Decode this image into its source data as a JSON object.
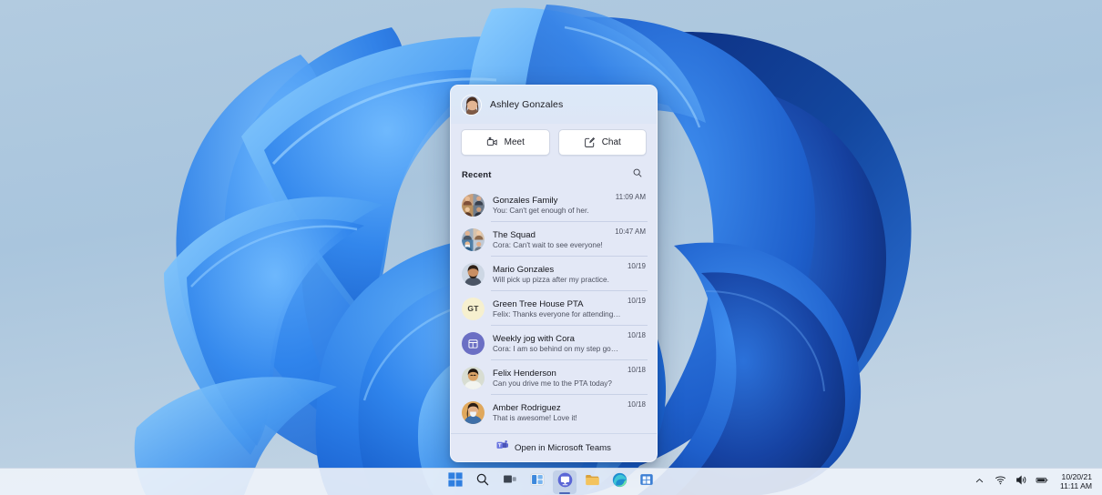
{
  "desktop": {
    "wallpaper_name": "windows-11-bloom-wallpaper",
    "background_color": "#a9c5dd"
  },
  "chat_flyout": {
    "account": {
      "name": "Ashley Gonzales",
      "avatar_name": "ashley-gonzales-avatar"
    },
    "actions": [
      {
        "label": "Meet",
        "icon": "video-camera-icon"
      },
      {
        "label": "Chat",
        "icon": "compose-message-icon"
      }
    ],
    "recent": {
      "title": "Recent",
      "search_icon": "search-icon"
    },
    "chats": [
      {
        "name": "Gonzales Family",
        "preview": "You: Can't get enough of her.",
        "time": "11:09 AM",
        "avatar_type": "group",
        "avatar_name": "gonzales-family-group-avatar"
      },
      {
        "name": "The Squad",
        "preview": "Cora: Can't wait to see everyone!",
        "time": "10:47 AM",
        "avatar_type": "group",
        "avatar_name": "the-squad-group-avatar"
      },
      {
        "name": "Mario Gonzales",
        "preview": "Will pick up pizza after my practice.",
        "time": "10/19",
        "avatar_type": "photo",
        "avatar_name": "mario-gonzales-avatar"
      },
      {
        "name": "Green Tree House PTA",
        "preview": "Felix: Thanks everyone for attending today.",
        "time": "10/19",
        "avatar_type": "initials",
        "avatar_initials": "GT",
        "avatar_color": "#f6f0cf",
        "avatar_name": "green-tree-house-pta-avatar"
      },
      {
        "name": "Weekly jog with Cora",
        "preview": "Cora: I am so behind on my step goals.",
        "time": "10/18",
        "avatar_type": "glyph",
        "avatar_color": "#6b6fc4",
        "avatar_name": "weekly-jog-calendar-avatar"
      },
      {
        "name": "Felix Henderson",
        "preview": "Can you drive me to the PTA today?",
        "time": "10/18",
        "avatar_type": "photo",
        "avatar_name": "felix-henderson-avatar"
      },
      {
        "name": "Amber Rodriguez",
        "preview": "That is awesome! Love it!",
        "time": "10/18",
        "avatar_type": "photo",
        "avatar_name": "amber-rodriguez-avatar"
      }
    ],
    "footer": {
      "label": "Open in Microsoft Teams",
      "icon": "microsoft-teams-icon"
    }
  },
  "taskbar": {
    "items": [
      {
        "name": "start-button",
        "icon": "windows-logo-icon",
        "active": false
      },
      {
        "name": "search-button",
        "icon": "search-icon",
        "active": false
      },
      {
        "name": "task-view-button",
        "icon": "task-view-icon",
        "active": false
      },
      {
        "name": "widgets-button",
        "icon": "widgets-icon",
        "active": false
      },
      {
        "name": "chat-button",
        "icon": "teams-chat-icon",
        "active": true
      },
      {
        "name": "file-explorer-button",
        "icon": "folder-icon",
        "active": false
      },
      {
        "name": "edge-button",
        "icon": "edge-icon",
        "active": false
      },
      {
        "name": "store-button",
        "icon": "microsoft-store-icon",
        "active": false
      }
    ],
    "tray": {
      "overflow_icon": "chevron-up-icon",
      "network_icon": "wifi-icon",
      "volume_icon": "speaker-icon",
      "battery_icon": "battery-icon",
      "date": "10/20/21",
      "time": "11:11 AM"
    }
  }
}
